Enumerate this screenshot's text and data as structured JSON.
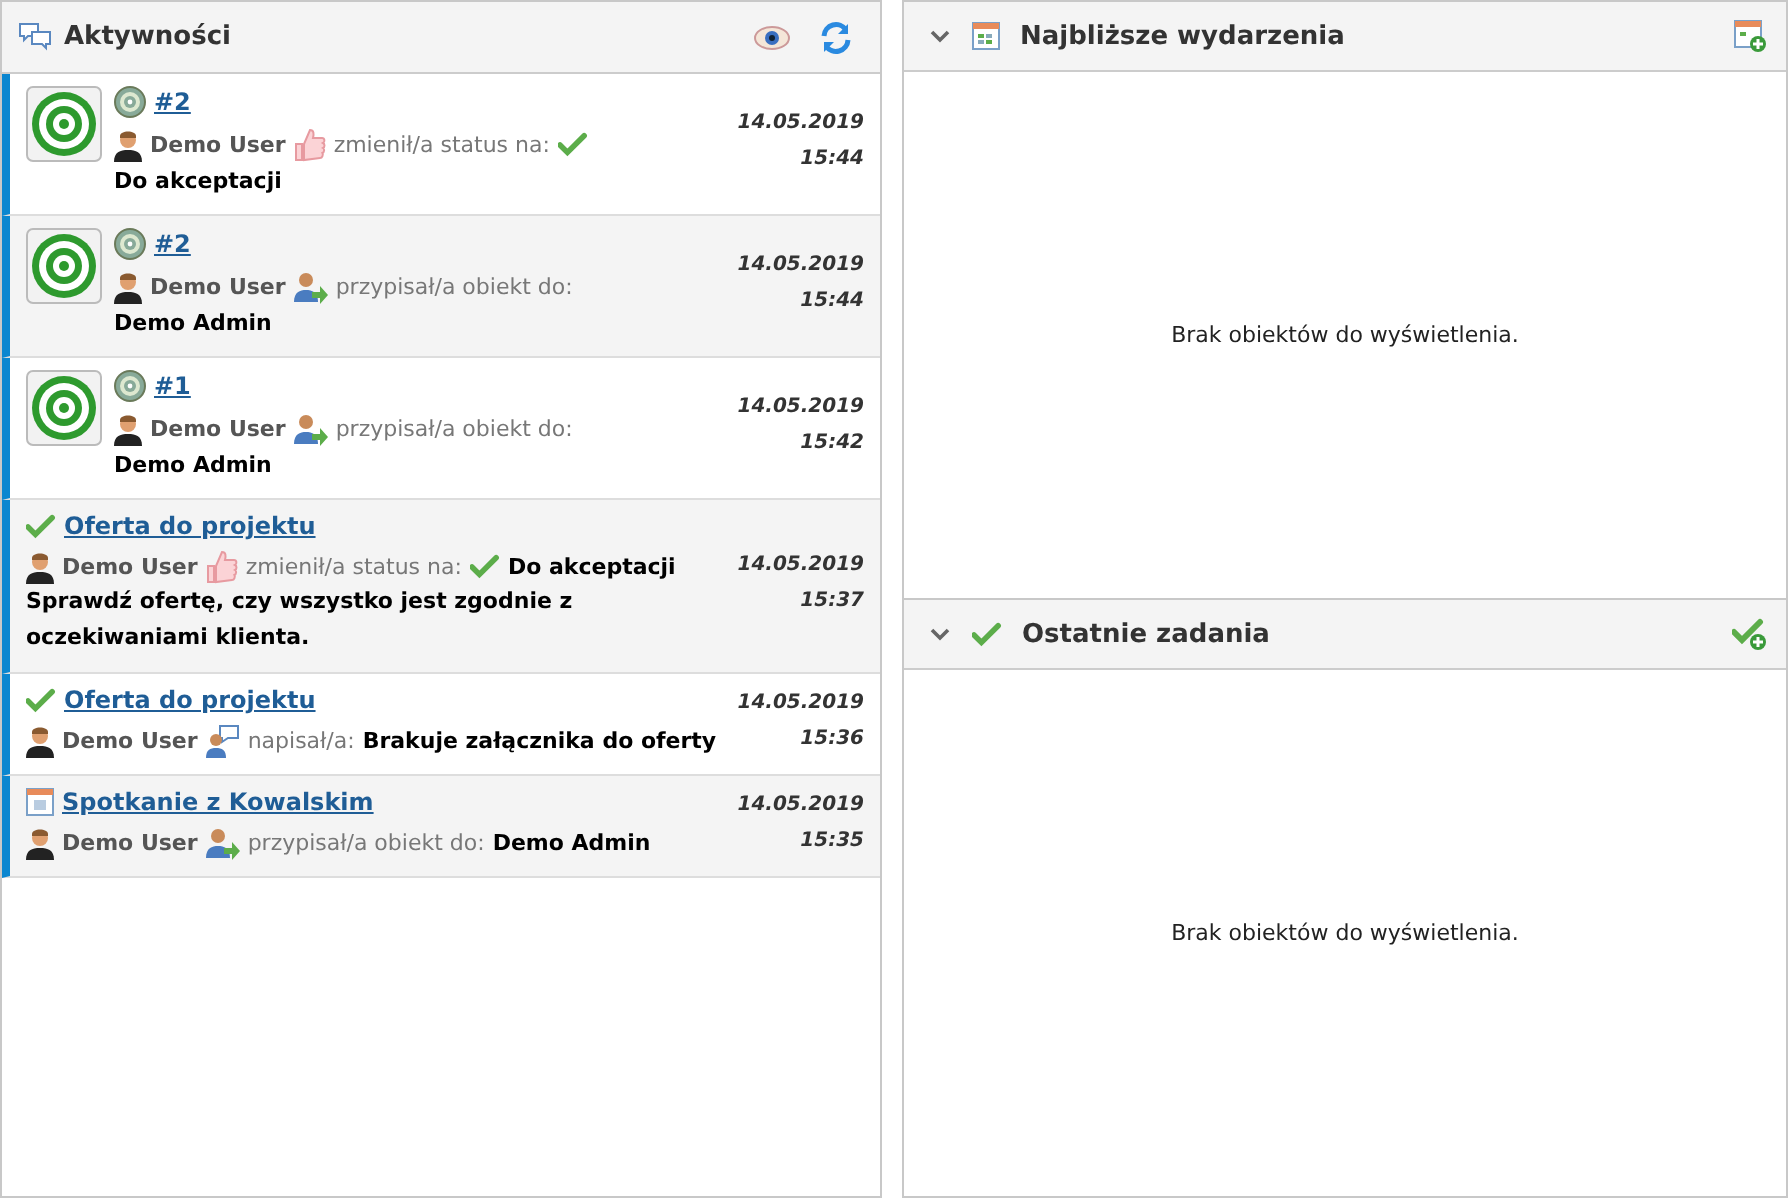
{
  "activity_panel": {
    "title": "Aktywności",
    "items": [
      {
        "kind": "task",
        "title": "#2",
        "action": {
          "kind": "status",
          "user": "Demo User",
          "verb": "zmienił/a status na:",
          "object": "Do akceptacji"
        },
        "date": "14.05.2019",
        "time": "15:44"
      },
      {
        "kind": "task",
        "title": "#2",
        "action": {
          "kind": "assign",
          "user": "Demo User",
          "verb": "przypisał/a obiekt do:",
          "object": "Demo Admin"
        },
        "date": "14.05.2019",
        "time": "15:44"
      },
      {
        "kind": "task",
        "title": "#1",
        "action": {
          "kind": "assign",
          "user": "Demo User",
          "verb": "przypisał/a obiekt do:",
          "object": "Demo Admin"
        },
        "date": "14.05.2019",
        "time": "15:42"
      },
      {
        "kind": "offer",
        "title": "Oferta do projektu",
        "action": {
          "kind": "status",
          "user": "Demo User",
          "verb": "zmienił/a status na:",
          "object": "Do akceptacji"
        },
        "note": "Sprawdź ofertę, czy wszystko jest zgodnie z oczekiwaniami klienta.",
        "date": "14.05.2019",
        "time": "15:37"
      },
      {
        "kind": "offer",
        "title": "Oferta do projektu",
        "action": {
          "kind": "comment",
          "user": "Demo User",
          "verb": "napisał/a:",
          "object": "Brakuje załącznika do oferty"
        },
        "date": "14.05.2019",
        "time": "15:36"
      },
      {
        "kind": "event",
        "title": "Spotkanie z Kowalskim",
        "action": {
          "kind": "assign",
          "user": "Demo User",
          "verb": "przypisał/a obiekt do:",
          "object": "Demo Admin"
        },
        "date": "14.05.2019",
        "time": "15:35"
      }
    ]
  },
  "widgets": [
    {
      "kind": "events",
      "title": "Najbliższe wydarzenia",
      "expanded": true,
      "empty_message": "Brak obiektów do wyświetlenia."
    },
    {
      "kind": "tasks",
      "title": "Ostatnie zadania",
      "expanded": true,
      "empty_message": "Brak obiektów do wyświetlenia."
    }
  ]
}
